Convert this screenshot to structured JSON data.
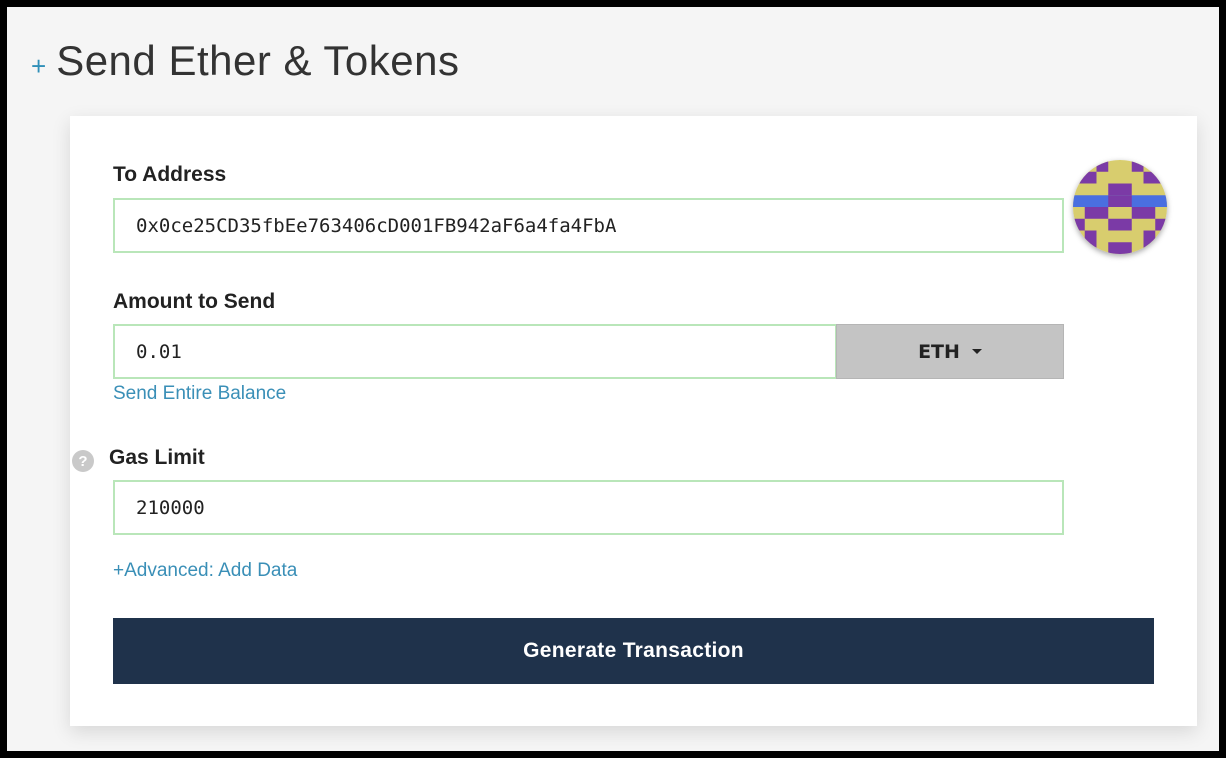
{
  "header": {
    "title": "Send Ether & Tokens",
    "plus_icon": "plus-icon"
  },
  "form": {
    "to_address": {
      "label": "To Address",
      "value": "0x0ce25CD35fbEe763406cD001FB942aF6a4fa4FbA"
    },
    "amount": {
      "label": "Amount to Send",
      "value": "0.01",
      "token": "ETH",
      "send_entire_balance": "Send Entire Balance"
    },
    "gas_limit": {
      "label": "Gas Limit",
      "value": "210000",
      "help_icon": "?"
    },
    "advanced_link": "+Advanced: Add Data",
    "generate_button": "Generate Transaction"
  },
  "colors": {
    "accent_link": "#3a8fb7",
    "button_bg": "#1f324b",
    "field_border": "#b9e6b9",
    "identicon_yellow": "#d8cd6e",
    "identicon_purple": "#7b3aa6",
    "identicon_blue": "#4a6fe0"
  },
  "icons": [
    "plus-icon",
    "help-icon",
    "caret-down-icon",
    "identicon-avatar"
  ]
}
